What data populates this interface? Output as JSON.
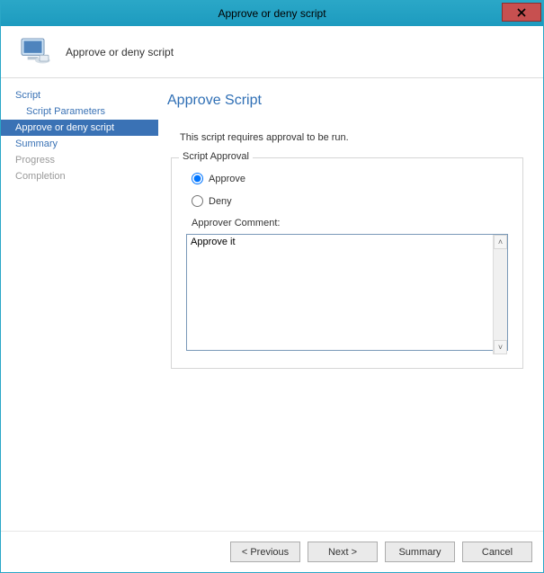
{
  "window": {
    "title": "Approve or deny script",
    "close_glyph": "✕"
  },
  "header": {
    "subtitle": "Approve or deny script"
  },
  "sidebar": {
    "items": [
      {
        "label": "Script",
        "kind": "link"
      },
      {
        "label": "Script Parameters",
        "kind": "link-child"
      },
      {
        "label": "Approve or deny script",
        "kind": "selected"
      },
      {
        "label": "Summary",
        "kind": "link"
      },
      {
        "label": "Progress",
        "kind": "muted"
      },
      {
        "label": "Completion",
        "kind": "muted"
      }
    ]
  },
  "main": {
    "heading": "Approve Script",
    "intro": "This script requires approval to be run.",
    "group_title": "Script Approval",
    "radio_approve": "Approve",
    "radio_deny": "Deny",
    "selected_radio": "approve",
    "comment_label": "Approver Comment:",
    "comment_value": "Approve it"
  },
  "buttons": {
    "previous": "< Previous",
    "next": "Next >",
    "summary": "Summary",
    "cancel": "Cancel"
  }
}
